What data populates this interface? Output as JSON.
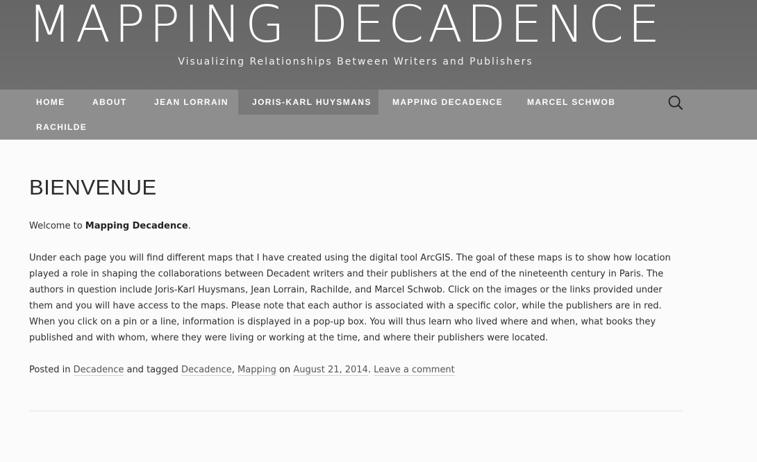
{
  "header": {
    "site_title": "MAPPING DECADENCE",
    "tagline": "Visualizing Relationships Between Writers and Publishers"
  },
  "nav": {
    "items": [
      {
        "label": "HOME"
      },
      {
        "label": "ABOUT"
      },
      {
        "label": "JEAN LORRAIN"
      },
      {
        "label": "JORIS-KARL HUYSMANS",
        "active": true
      },
      {
        "label": "MAPPING DECADENCE"
      },
      {
        "label": "MARCEL SCHWOB"
      },
      {
        "label": "RACHILDE"
      }
    ],
    "search_icon": "search-icon"
  },
  "post": {
    "title": "BIENVENUE",
    "welcome_prefix": "Welcome to ",
    "welcome_bold": "Mapping Decadence",
    "welcome_suffix": ".",
    "body": "Under each page you will find different maps that I have created using the digital tool ArcGIS. The goal of these maps is to show how location played a role in shaping the collaborations between Decadent writers and their publishers at the end of the nineteenth century in Paris. The authors in question include Joris-Karl Huysmans, Jean Lorrain, Rachilde, and Marcel Schwob. Click on the images or the links provided under them and you will have access to the maps. Please note that each author is associated with a specific color, while the publishers are in red. When you click on a pin or a line, information is displayed in a pop-up box. You will thus learn who lived where and when, what books they published and with whom, where they were living or working at the time, and where their publishers were located.",
    "meta": {
      "posted_in": "Posted in ",
      "category": "Decadence",
      "and_tagged": " and tagged ",
      "tag1": "Decadence",
      "comma": ", ",
      "tag2": "Mapping",
      "on": " on ",
      "date": "August 21, 2014",
      "period": ". ",
      "comment_link": "Leave a comment"
    }
  },
  "colors": {
    "header_bg": "#676767",
    "nav_bg": "#8e8e8e",
    "nav_active_bg": "#797979",
    "page_bg": "#fbfbfb"
  }
}
